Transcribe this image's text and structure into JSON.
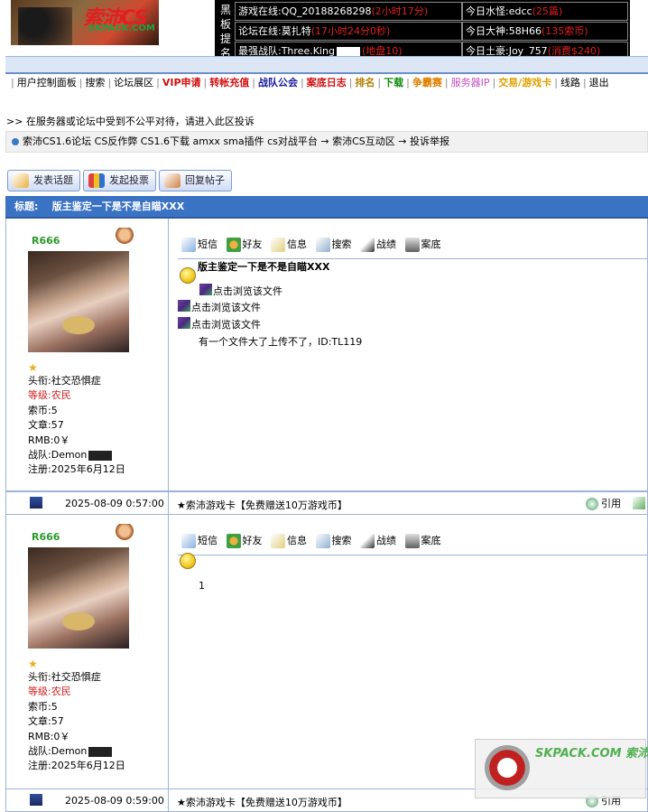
{
  "header": {
    "logo_title": "索沛CS",
    "logo_sub": "SKPACK.COM",
    "board_label": "黑板提名",
    "board_rows": [
      {
        "left": "游戏在线:QQ_20188268298",
        "left_extra": "(2小时17分)",
        "right": "今日水怪:edcc",
        "right_extra": "(25篇)"
      },
      {
        "left": "论坛在线:莫扎特",
        "left_extra": "(17小时24分0秒)",
        "right": "今日大神:58H66",
        "right_extra": "(135索币)"
      },
      {
        "left": "最强战队:Three.King",
        "left_extra": "(地盘10)",
        "right": "今日土豪:Joy_757",
        "right_extra": "(消费$240)"
      }
    ]
  },
  "menu": [
    {
      "label": "用户控制面板",
      "color": "#000"
    },
    {
      "label": "搜索",
      "color": "#000"
    },
    {
      "label": "论坛展区",
      "color": "#000"
    },
    {
      "label": "VIP申请",
      "color": "#d01010"
    },
    {
      "label": "转帐充值",
      "color": "#d01010"
    },
    {
      "label": "战队公会",
      "color": "#1a1aa0"
    },
    {
      "label": "案底日志",
      "color": "#d01010"
    },
    {
      "label": "排名",
      "color": "#b08000"
    },
    {
      "label": "下载",
      "color": "#108a10"
    },
    {
      "label": "争霸赛",
      "color": "#e08000"
    },
    {
      "label": "服务器IP",
      "color": "#c050c0"
    },
    {
      "label": "交易/游戏卡",
      "color": "#e0a000"
    },
    {
      "label": "线路",
      "color": "#000"
    },
    {
      "label": "退出",
      "color": "#000"
    }
  ],
  "notice": ">> 在服务器或论坛中受到不公平对待，请进入此区投诉",
  "breadcrumb": "索沛CS1.6论坛 CS反作弊 CS1.6下载 amxx sma插件 cs对战平台 → 索沛CS互动区 → 投诉举报",
  "buttons": {
    "new_topic": "发表话题",
    "new_poll": "发起投票",
    "reply": "回复帖子"
  },
  "thread": {
    "title_label": "标题:",
    "title": "版主鉴定一下是不是自瞄XXX"
  },
  "tools": [
    "短信",
    "好友",
    "信息",
    "搜索",
    "战绩",
    "案底"
  ],
  "posts": [
    {
      "user": {
        "name": "R666",
        "rank_label": "头衔:",
        "rank": "社交恐惧症",
        "level_label": "等级:",
        "level": "农民",
        "coins_label": "索币:",
        "coins": "5",
        "articles_label": "文章:",
        "articles": "57",
        "rmb_label": "RMB:",
        "rmb": "0￥",
        "team_label": "战队:",
        "team": "Demon",
        "reg_label": "注册:",
        "reg": "2025年6月12日"
      },
      "post_title": "版主鉴定一下是不是自瞄XXX",
      "files": [
        "点击浏览该文件",
        "点击浏览该文件",
        "点击浏览该文件"
      ],
      "body": "有一个文件大了上传不了，ID:TL119",
      "time": "2025-08-09 0:57:00",
      "signature": "★索沛游戏卡【免费赠送10万游戏币】",
      "quote": "引用"
    },
    {
      "user": {
        "name": "R666",
        "rank_label": "头衔:",
        "rank": "社交恐惧症",
        "level_label": "等级:",
        "level": "农民",
        "coins_label": "索币:",
        "coins": "5",
        "articles_label": "文章:",
        "articles": "57",
        "rmb_label": "RMB:",
        "rmb": "0￥",
        "team_label": "战队:",
        "team": "Demon",
        "reg_label": "注册:",
        "reg": "2025年6月12日"
      },
      "body": "1",
      "time": "2025-08-09 0:59:00",
      "signature": "★索沛游戏卡【免费赠送10万游戏币】",
      "quote": "引用"
    }
  ],
  "watermark": "SKPACK.COM 索沛CS"
}
